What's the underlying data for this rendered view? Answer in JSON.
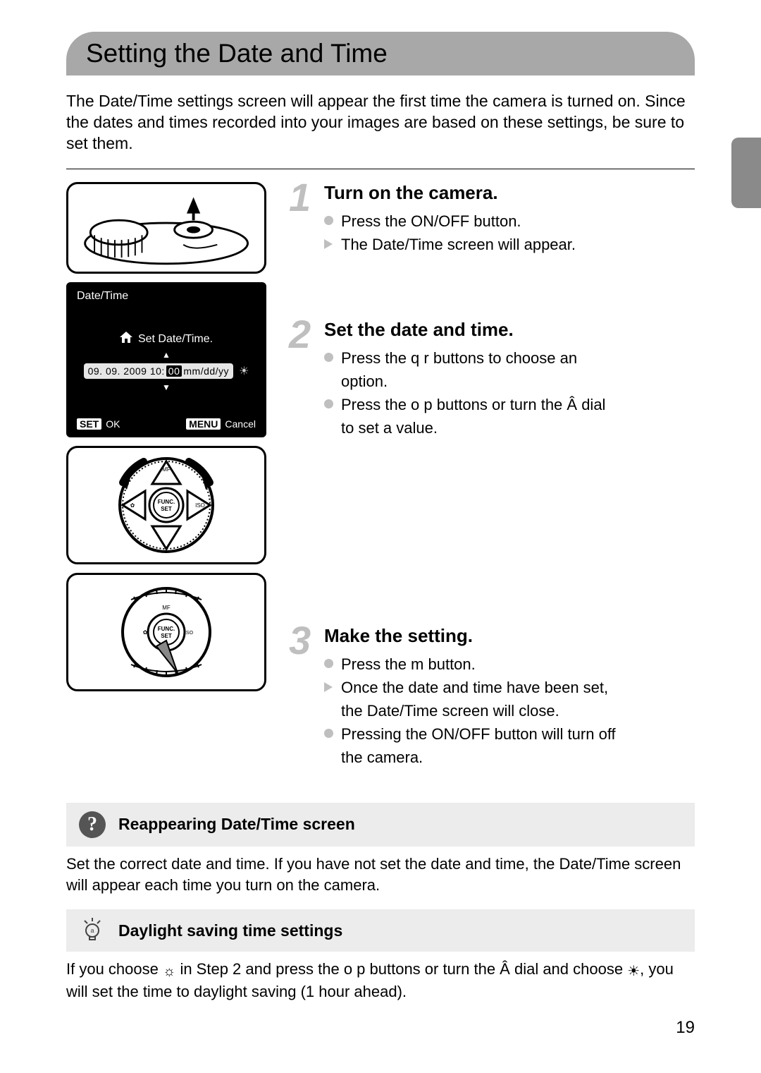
{
  "page": {
    "title": "Setting the Date and Time",
    "intro": "The Date/Time settings screen will appear the first time the camera is turned on. Since the dates and times recorded into your images are based on these settings, be sure to set them.",
    "page_number": "19"
  },
  "screen": {
    "title": "Date/Time",
    "prompt": "Set Date/Time.",
    "value_prefix": "09. 09. 2009 10:",
    "value_selected": "00",
    "value_suffix": " mm/dd/yy",
    "set_tag": "SET",
    "set_label": "OK",
    "menu_tag": "MENU",
    "menu_label": "Cancel"
  },
  "steps": [
    {
      "num": "1",
      "title": "Turn on the camera.",
      "lines": [
        {
          "kind": "dot",
          "text": "Press the ON/OFF button."
        },
        {
          "kind": "tri",
          "text": "The Date/Time screen will appear."
        }
      ]
    },
    {
      "num": "2",
      "title": "Set the date and time.",
      "lines": [
        {
          "kind": "dot",
          "text": "Press the q r  buttons to choose an"
        },
        {
          "kind": "sub",
          "text": "option."
        },
        {
          "kind": "dot",
          "text": "Press the o  p   buttons or turn the Â     dial"
        },
        {
          "kind": "sub",
          "text": "to set a value."
        }
      ]
    },
    {
      "num": "3",
      "title": "Make the setting.",
      "lines": [
        {
          "kind": "dot",
          "text": "Press the m   button."
        },
        {
          "kind": "tri",
          "text": "Once the date and time have been set,"
        },
        {
          "kind": "sub",
          "text": "the Date/Time screen will close."
        },
        {
          "kind": "dot",
          "text": "Pressing the ON/OFF button will turn off"
        },
        {
          "kind": "sub",
          "text": "the camera."
        }
      ]
    }
  ],
  "notes": {
    "reappear": {
      "title": "Reappearing Date/Time screen",
      "body": "Set the correct date and time. If you have not set the date and time, the Date/Time screen will appear each time you turn on the camera."
    },
    "dst": {
      "title": "Daylight saving time settings",
      "body_before_icon1": "If you choose ",
      "body_between": " in Step 2 and press the o  p   buttons or turn the Â     dial and choose ",
      "body_after_icon2": ", you will set the time to daylight saving (1 hour ahead)."
    }
  }
}
